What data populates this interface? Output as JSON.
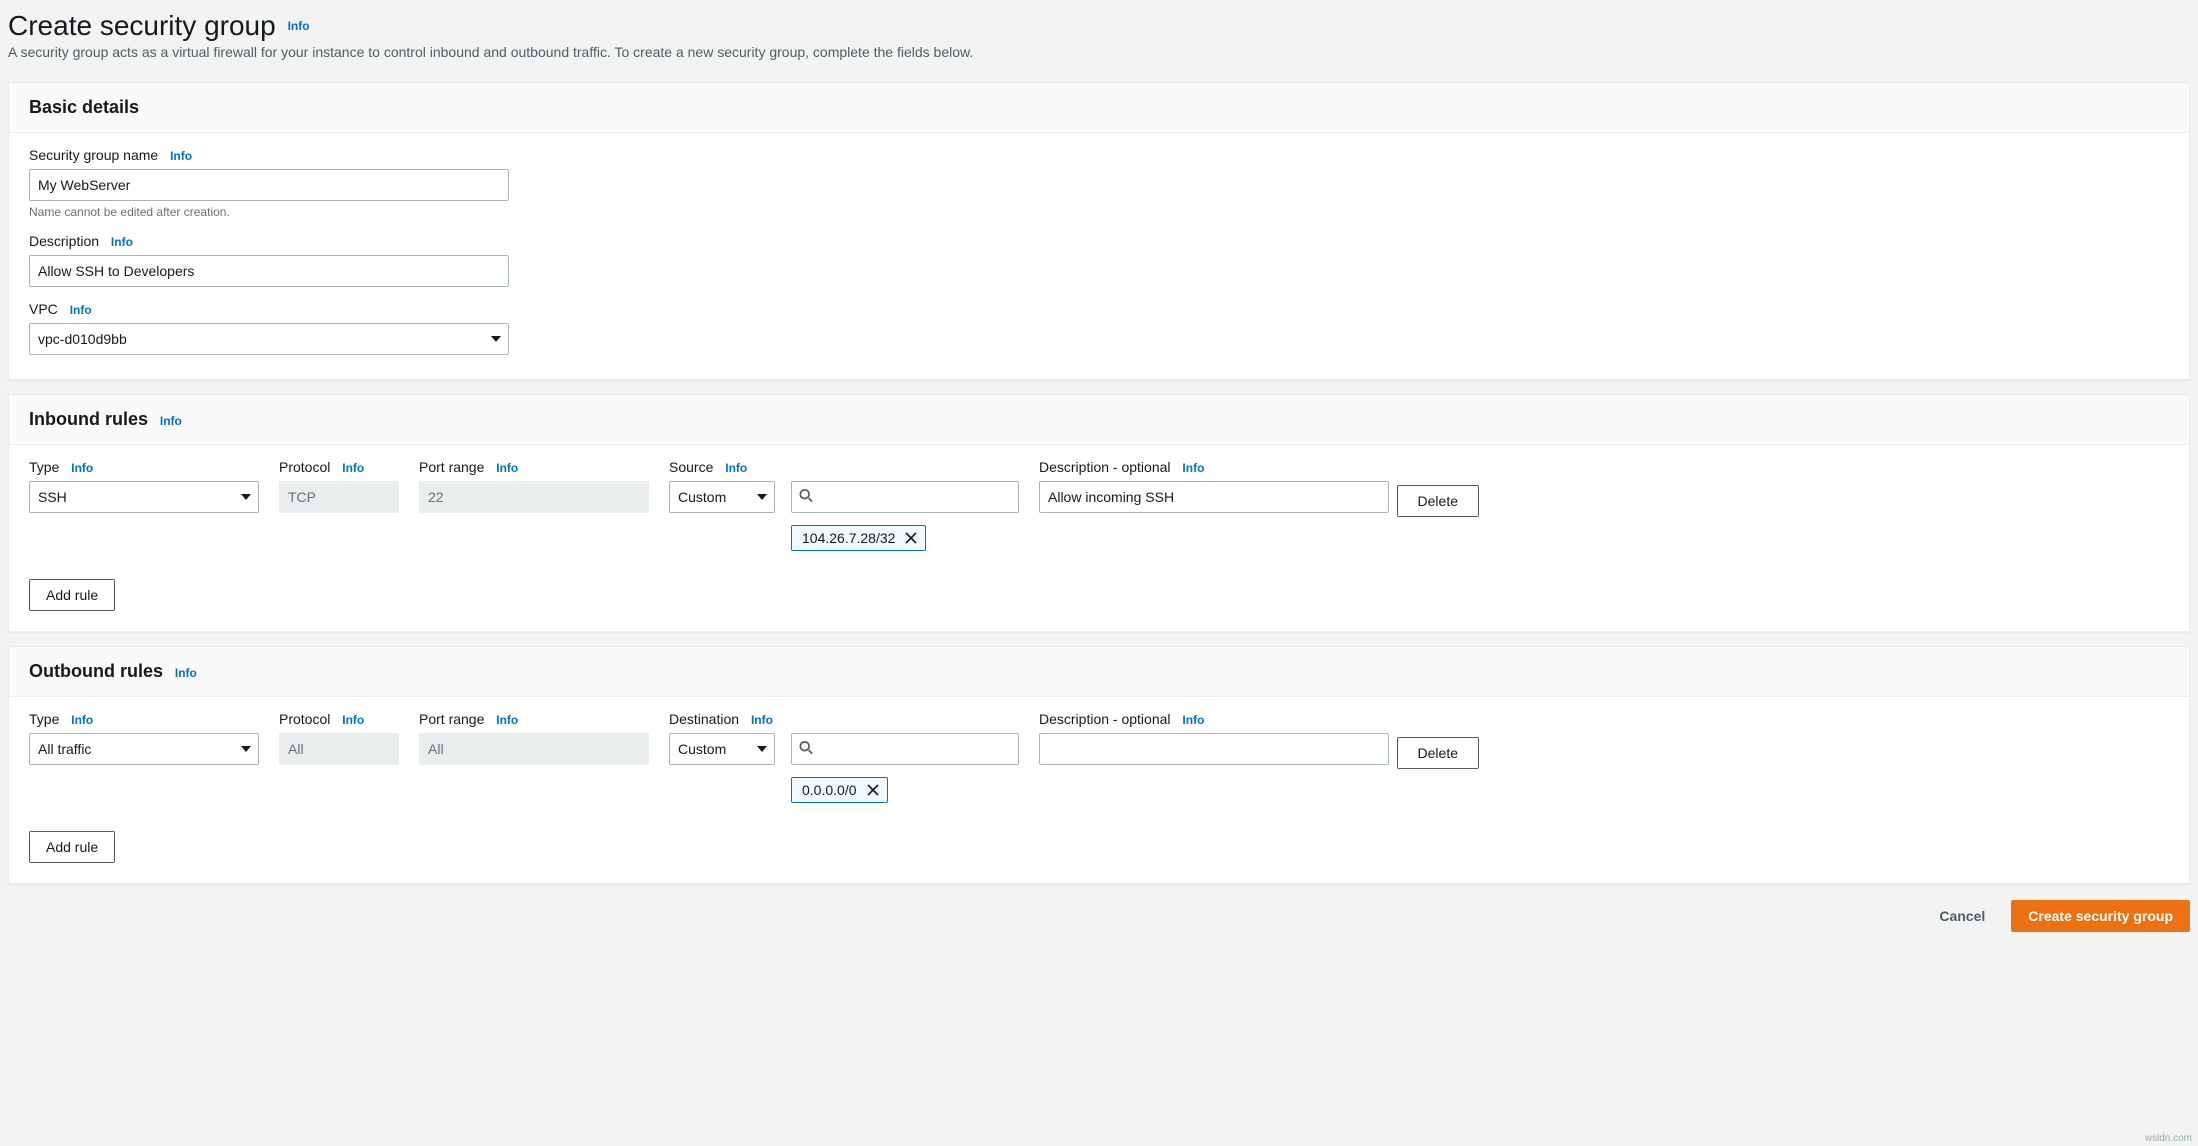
{
  "header": {
    "title": "Create security group",
    "info": "Info",
    "subtitle": "A security group acts as a virtual firewall for your instance to control inbound and outbound traffic. To create a new security group, complete the fields below."
  },
  "basic": {
    "panel_title": "Basic details",
    "name_label": "Security group name",
    "name_info": "Info",
    "name_value": "My WebServer",
    "name_helper": "Name cannot be edited after creation.",
    "desc_label": "Description",
    "desc_info": "Info",
    "desc_value": "Allow SSH to Developers",
    "vpc_label": "VPC",
    "vpc_info": "Info",
    "vpc_value": "vpc-d010d9bb"
  },
  "inbound": {
    "panel_title": "Inbound rules",
    "info": "Info",
    "cols": {
      "type": "Type",
      "type_info": "Info",
      "protocol": "Protocol",
      "protocol_info": "Info",
      "port": "Port range",
      "port_info": "Info",
      "source": "Source",
      "source_info": "Info",
      "desc": "Description - optional",
      "desc_info": "Info"
    },
    "rule": {
      "type": "SSH",
      "protocol": "TCP",
      "port": "22",
      "source_mode": "Custom",
      "source_search": "",
      "source_chip": "104.26.7.28/32",
      "description": "Allow incoming SSH",
      "delete": "Delete"
    },
    "add_rule": "Add rule"
  },
  "outbound": {
    "panel_title": "Outbound rules",
    "info": "Info",
    "cols": {
      "type": "Type",
      "type_info": "Info",
      "protocol": "Protocol",
      "protocol_info": "Info",
      "port": "Port range",
      "port_info": "Info",
      "dest": "Destination",
      "dest_info": "Info",
      "desc": "Description - optional",
      "desc_info": "Info"
    },
    "rule": {
      "type": "All traffic",
      "protocol": "All",
      "port": "All",
      "dest_mode": "Custom",
      "dest_search": "",
      "dest_chip": "0.0.0.0/0",
      "description": "",
      "delete": "Delete"
    },
    "add_rule": "Add rule"
  },
  "footer": {
    "cancel": "Cancel",
    "submit": "Create security group"
  },
  "watermark": "wsldn.com"
}
